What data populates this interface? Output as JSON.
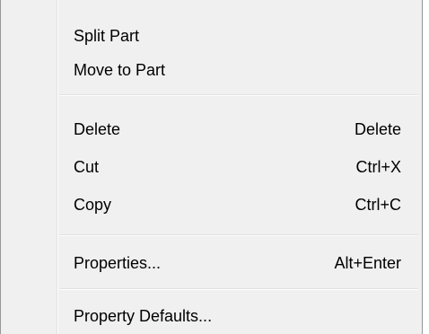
{
  "context_menu": {
    "items": [
      {
        "label": "Split Part",
        "shortcut": ""
      },
      {
        "label": "Move to Part",
        "shortcut": ""
      },
      {
        "label": "Delete",
        "shortcut": "Delete"
      },
      {
        "label": "Cut",
        "shortcut": "Ctrl+X"
      },
      {
        "label": "Copy",
        "shortcut": "Ctrl+C"
      },
      {
        "label": "Properties...",
        "shortcut": "Alt+Enter"
      },
      {
        "label": "Property Defaults...",
        "shortcut": ""
      }
    ]
  }
}
